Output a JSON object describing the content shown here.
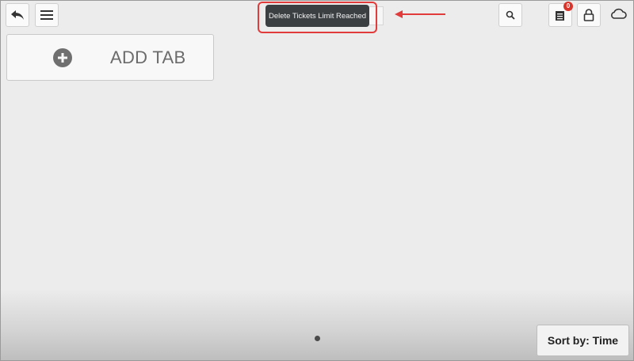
{
  "toolbar": {
    "back_icon": "back-arrow-icon",
    "menu_icon": "hamburger-menu-icon",
    "search_icon": "search-icon",
    "tickets_icon": "tickets-icon",
    "tickets_badge": "0",
    "lock_icon": "lock-icon",
    "cloud_icon": "cloud-icon"
  },
  "toast": {
    "message": "Delete Tickets Limit Reached"
  },
  "tabs": {
    "add_tab_label": "ADD TAB",
    "add_icon": "plus-circle-icon"
  },
  "footer": {
    "sort_label": "Sort by: Time",
    "page_indicator": "1"
  },
  "colors": {
    "background": "#ececec",
    "toast_bg": "#3b3f42",
    "highlight": "#e23b3b",
    "badge": "#d9342b"
  }
}
